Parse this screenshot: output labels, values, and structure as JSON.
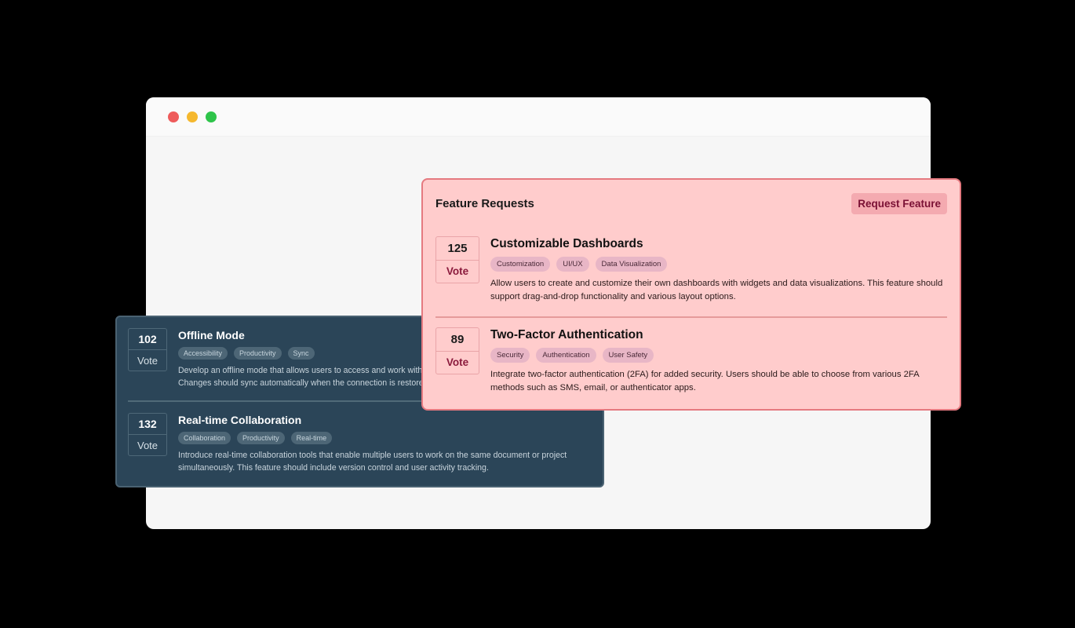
{
  "window": {
    "traffic_lights": [
      {
        "name": "close",
        "color": "#ee5b5b"
      },
      {
        "name": "minimize",
        "color": "#f5b82e"
      },
      {
        "name": "maximize",
        "color": "#2ec44a"
      }
    ]
  },
  "feature_panel": {
    "title": "Feature Requests",
    "request_button": "Request Feature",
    "items": [
      {
        "votes": "125",
        "vote_label": "Vote",
        "title": "Customizable Dashboards",
        "tags": [
          "Customization",
          "UI/UX",
          "Data Visualization"
        ],
        "description": "Allow users to create and customize their own dashboards with widgets and data visualizations. This feature should support drag-and-drop functionality and various layout options."
      },
      {
        "votes": "89",
        "vote_label": "Vote",
        "title": "Two-Factor Authentication",
        "tags": [
          "Security",
          "Authentication",
          "User Safety"
        ],
        "description": " Integrate two-factor authentication (2FA) for added security. Users should be able to choose from various 2FA methods such as SMS, email, or authenticator apps."
      }
    ]
  },
  "dark_panel": {
    "items": [
      {
        "votes": "102",
        "vote_label": "Vote",
        "title": "Offline Mode",
        "tags": [
          "Accessibility",
          "Productivity",
          "Sync"
        ],
        "description": "Develop an offline mode that allows users to access and work with their data without an internet connection. Changes should sync automatically when the connection is restored."
      },
      {
        "votes": "132",
        "vote_label": "Vote",
        "title": "Real-time Collaboration",
        "tags": [
          "Collaboration",
          "Productivity",
          "Real-time"
        ],
        "description": "Introduce real-time collaboration tools that enable multiple users to work on the same document or project simultaneously. This feature should include version control and user activity tracking."
      }
    ]
  }
}
